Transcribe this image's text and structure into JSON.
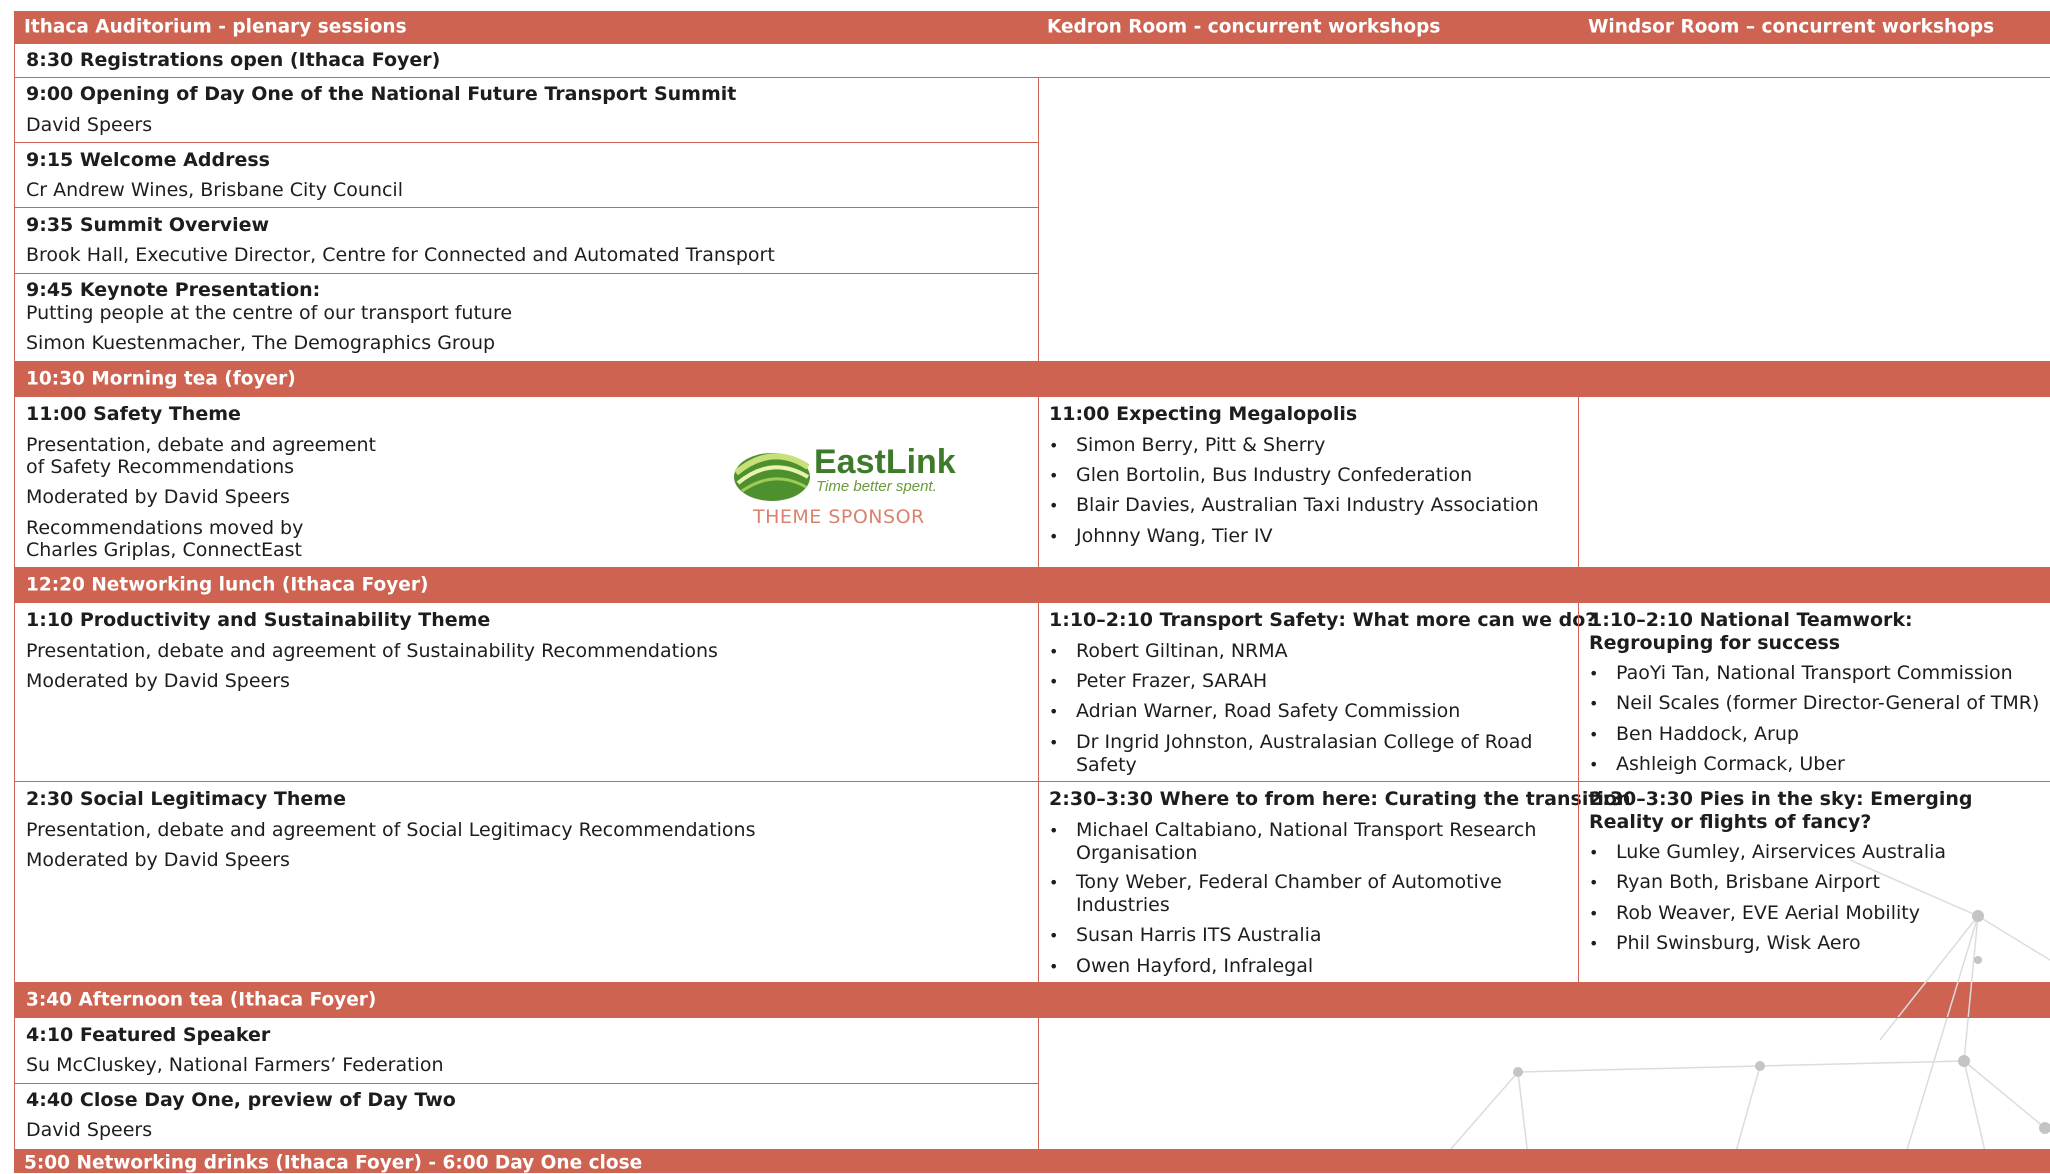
{
  "columns": {
    "plenary": "Ithaca Auditorium - plenary sessions",
    "kedron": "Kedron Room - concurrent workshops",
    "windsor": "Windsor Room – concurrent workshops"
  },
  "registrations": "8:30 Registrations open (Ithaca Foyer)",
  "opening": {
    "title": "9:00 Opening of Day One of the National Future Transport Summit",
    "speaker": "David Speers"
  },
  "welcome": {
    "title": "9:15 Welcome Address",
    "speaker": "Cr Andrew Wines, Brisbane City Council"
  },
  "overview": {
    "title": "9:35 Summit Overview",
    "speaker": "Brook Hall, Executive Director, Centre for Connected and Automated Transport"
  },
  "keynote": {
    "title": "9:45 Keynote Presentation:",
    "subtitle": "Putting people at the centre of our transport future",
    "speaker": "Simon Kuestenmacher, The Demographics Group"
  },
  "morning_tea": "10:30 Morning tea (foyer)",
  "safety": {
    "title": "11:00 Safety Theme",
    "desc_1": "Presentation, debate and agreement",
    "desc_2": "of Safety Recommendations",
    "moderator": "Moderated by David Speers",
    "moved_1": "Recommendations moved by",
    "moved_2": "Charles Griplas, ConnectEast",
    "sponsor_name": "EastLink",
    "sponsor_tagline": "Time better spent.",
    "sponsor_label": "THEME SPONSOR"
  },
  "megalopolis": {
    "title": "11:00 Expecting Megalopolis",
    "speakers": [
      "Simon Berry, Pitt & Sherry",
      "Glen Bortolin, Bus Industry Confederation",
      "Blair Davies, Australian Taxi Industry Association",
      "Johnny Wang, Tier IV"
    ]
  },
  "lunch": "12:20 Networking lunch (Ithaca Foyer)",
  "productivity": {
    "title": "1:10 Productivity and Sustainability Theme",
    "desc": "Presentation, debate and agreement of Sustainability Recommendations",
    "moderator": "Moderated by David Speers"
  },
  "transport_safety": {
    "title": "1:10–2:10 Transport Safety: What more can we do?",
    "speakers": [
      "Robert Giltinan, NRMA",
      "Peter Frazer, SARAH",
      "Adrian Warner, Road Safety Commission",
      "Dr Ingrid Johnston, Australasian College of Road Safety"
    ]
  },
  "teamwork": {
    "title": "1:10–2:10 National Teamwork: Regrouping for success",
    "speakers": [
      "PaoYi Tan, National Transport Commission",
      "Neil Scales (former Director-General of TMR)",
      "Ben Haddock, Arup",
      "Ashleigh Cormack, Uber"
    ]
  },
  "social": {
    "title": "2:30 Social Legitimacy Theme",
    "desc": "Presentation, debate and agreement of Social Legitimacy Recommendations",
    "moderator": "Moderated by David Speers"
  },
  "curating": {
    "title": "2:30–3:30 Where to from here: Curating the transition",
    "speakers": [
      "Michael Caltabiano, National Transport Research Organisation",
      "Tony Weber, Federal Chamber of Automotive Industries",
      "Susan Harris ITS Australia",
      "Owen Hayford, Infralegal"
    ]
  },
  "pies": {
    "title": "2:30–3:30 Pies in the sky: Emerging Reality or flights of fancy?",
    "speakers": [
      "Luke Gumley, Airservices Australia",
      "Ryan Both, Brisbane Airport",
      "Rob Weaver, EVE Aerial Mobility",
      "Phil Swinsburg, Wisk Aero"
    ]
  },
  "afternoon_tea": "3:40 Afternoon tea (Ithaca Foyer)",
  "featured": {
    "title": "4:10 Featured Speaker",
    "speaker": "Su McCluskey, National Farmers’ Federation"
  },
  "close": {
    "title": "4:40 Close Day One, preview of Day Two",
    "speaker": "David Speers"
  },
  "drinks": "5:00 Networking drinks (Ithaca Foyer) - 6:00 Day One close",
  "colors": {
    "accent": "#cf6351",
    "sponsor_green": "#3d7a2a",
    "sponsor_label": "#d9826f"
  }
}
